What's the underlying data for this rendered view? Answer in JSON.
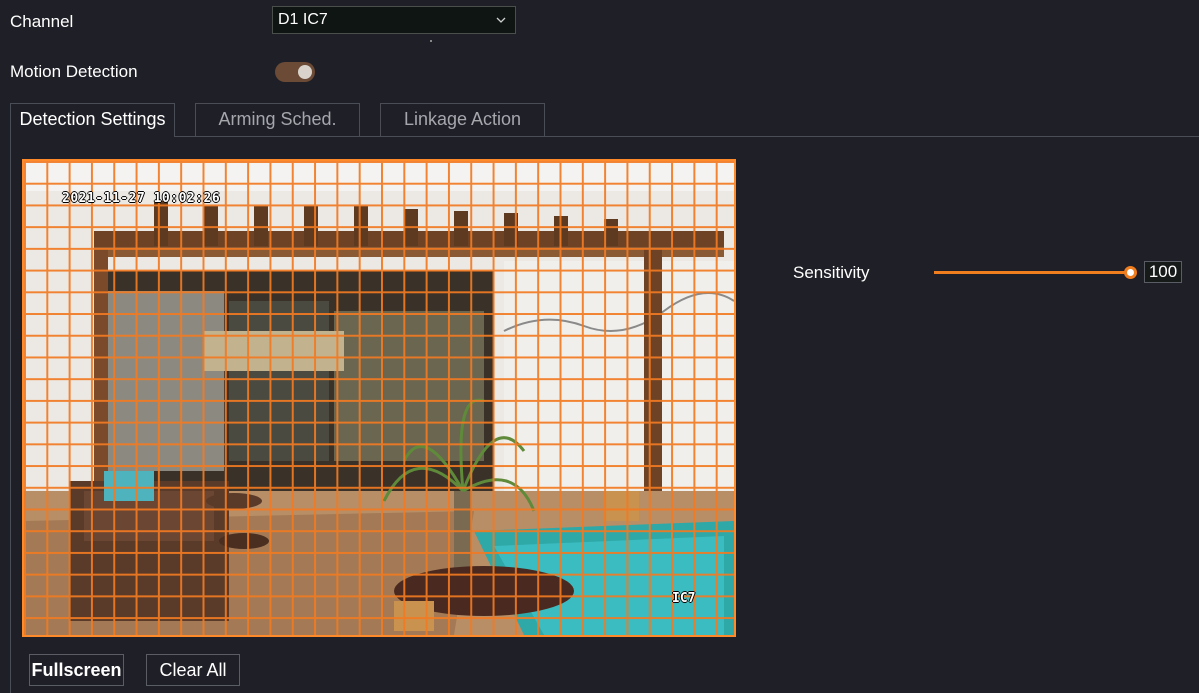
{
  "channel": {
    "label": "Channel",
    "value": "D1 IC7"
  },
  "motion_detection": {
    "label": "Motion Detection",
    "enabled": true
  },
  "tabs": [
    {
      "label": "Detection Settings",
      "active": true
    },
    {
      "label": "Arming Sched.",
      "active": false
    },
    {
      "label": "Linkage Action",
      "active": false
    }
  ],
  "video": {
    "timestamp": "2021-11-27 10:02:26",
    "camera_name": "IC7",
    "grid_columns": 32,
    "grid_rows": 22
  },
  "sensitivity": {
    "label": "Sensitivity",
    "value": "100",
    "max": 100
  },
  "buttons": {
    "fullscreen": "Fullscreen",
    "clear_all": "Clear All"
  },
  "colors": {
    "accent": "#f07d1e",
    "grid": "#f27a22",
    "background": "#1f1f27"
  }
}
